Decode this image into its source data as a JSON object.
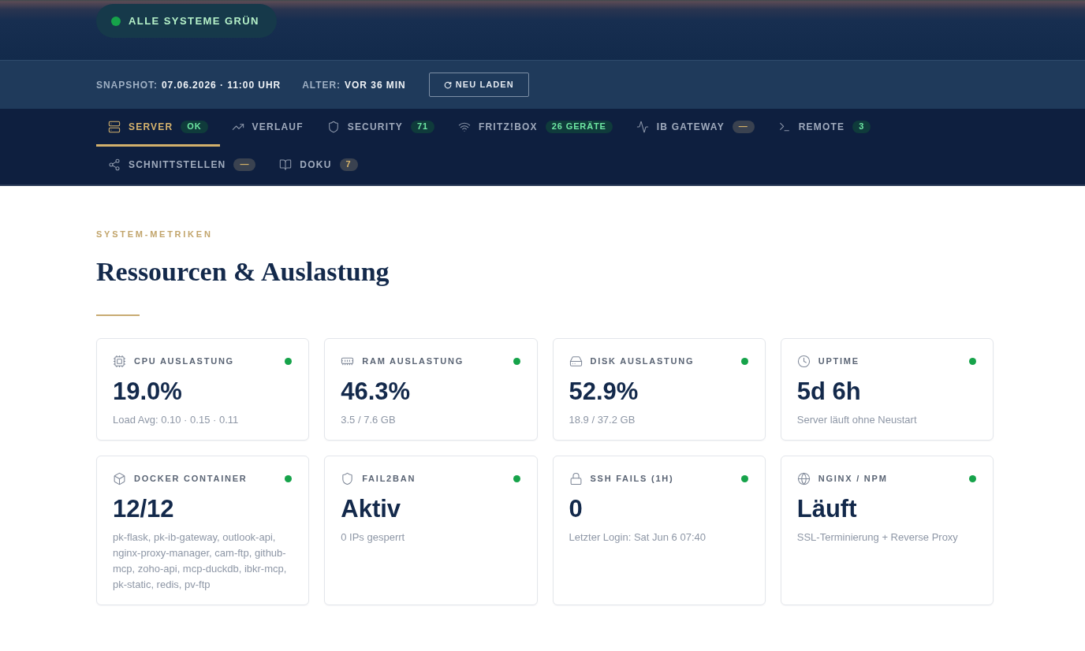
{
  "status": {
    "text": "ALLE SYSTEME GRÜN",
    "ok": true
  },
  "meta": [
    {
      "label": "SNAPSHOT:",
      "value": "07.06.2026 · 11:00 UHR"
    },
    {
      "label": "ALTER:",
      "value": "VOR 36 MIN"
    }
  ],
  "reload_button": {
    "label": "NEU LADEN"
  },
  "tabs": [
    {
      "label": "SERVER",
      "selected": true,
      "badge": {
        "text": "OK",
        "kind": "success"
      }
    },
    {
      "label": "VERLAUF",
      "selected": false
    },
    {
      "label": "SECURITY",
      "selected": false,
      "badge": {
        "text": "71",
        "kind": "success"
      }
    },
    {
      "label": "FRITZ!BOX",
      "selected": false,
      "badge": {
        "text": "26 GERÄTE",
        "kind": "success"
      }
    },
    {
      "label": "IB GATEWAY",
      "selected": false,
      "badge": {
        "text": "—",
        "kind": "neutral"
      }
    },
    {
      "label": "REMOTE",
      "selected": false,
      "badge": {
        "text": "3",
        "kind": "success"
      }
    },
    {
      "label": "SCHNITTSTELLEN",
      "selected": false,
      "badge": {
        "text": "—",
        "kind": "neutral"
      }
    },
    {
      "label": "DOKU",
      "selected": false,
      "badge": {
        "text": "7",
        "kind": "neutral"
      }
    }
  ],
  "section": {
    "eyebrow": "SYSTEM-METRIKEN",
    "title": "Ressourcen & Auslastung"
  },
  "cards": [
    {
      "label": "CPU AUSLASTUNG",
      "ok": true,
      "value": "19.0%",
      "detail": "Load Avg: 0.10 · 0.15 · 0.11"
    },
    {
      "label": "RAM AUSLASTUNG",
      "ok": true,
      "value": "46.3%",
      "detail": "3.5 / 7.6 GB"
    },
    {
      "label": "DISK AUSLASTUNG",
      "ok": true,
      "value": "52.9%",
      "detail": "18.9 / 37.2 GB"
    },
    {
      "label": "UPTIME",
      "ok": true,
      "value": "5d 6h",
      "detail": "Server läuft ohne Neustart"
    },
    {
      "label": "DOCKER CONTAINER",
      "ok": true,
      "value": "12/12",
      "detail": "pk-flask, pk-ib-gateway, outlook-api, nginx-proxy-manager, cam-ftp, github-mcp, zoho-api, mcp-duckdb, ibkr-mcp, pk-static, redis, pv-ftp"
    },
    {
      "label": "FAIL2BAN",
      "ok": true,
      "value": "Aktiv",
      "detail": "0 IPs gesperrt"
    },
    {
      "label": "SSH FAILS (1H)",
      "ok": true,
      "value": "0",
      "detail": "Letzter Login: Sat Jun 6 07:40"
    },
    {
      "label": "NGINX / NPM",
      "ok": true,
      "value": "Läuft",
      "detail": "SSL-Terminierung + Reverse Proxy"
    }
  ]
}
